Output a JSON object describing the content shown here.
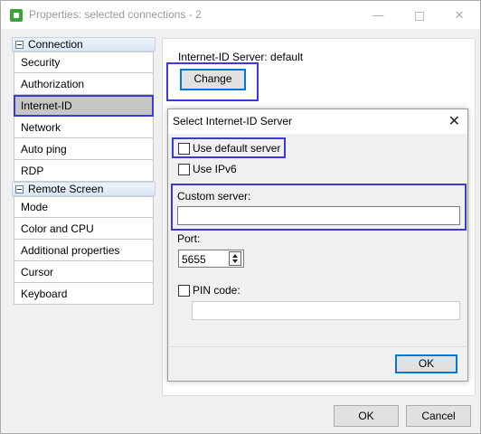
{
  "window": {
    "title": "Properties: selected connections - 2",
    "min_symbol": "—",
    "close_symbol": "✕"
  },
  "nav": {
    "groups": [
      {
        "label": "Connection",
        "items": [
          "Security",
          "Authorization",
          "Internet-ID",
          "Network",
          "Auto ping",
          "RDP"
        ]
      },
      {
        "label": "Remote Screen",
        "items": [
          "Mode",
          "Color and CPU",
          "Additional properties",
          "Cursor",
          "Keyboard"
        ]
      }
    ],
    "selected": "Internet-ID"
  },
  "main": {
    "server_label": "Internet-ID Server: default",
    "change_label": "Change",
    "ok_label": "OK",
    "cancel_label": "Cancel"
  },
  "dialog": {
    "title": "Select Internet-ID Server",
    "close_symbol": "✕",
    "use_default_label": "Use default server",
    "use_default_checked": false,
    "use_ipv6_label": "Use IPv6",
    "use_ipv6_checked": false,
    "custom_server_label": "Custom server:",
    "custom_server_value": "",
    "port_label": "Port:",
    "port_value": "5655",
    "pin_label": "PIN code:",
    "pin_checked": false,
    "pin_value": "",
    "ok_label": "OK"
  },
  "colors": {
    "highlight": "#3a3ad8",
    "focus": "#0078d7",
    "app_icon": "#3aa335"
  }
}
